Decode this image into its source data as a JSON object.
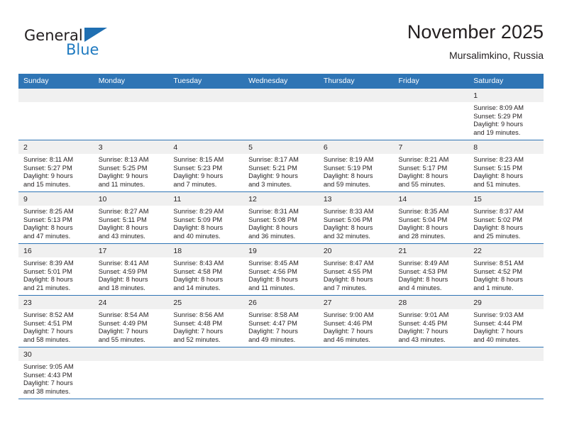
{
  "logo": {
    "word1": "General",
    "word2": "Blue",
    "flag_icon": "blue-flag-triangle-icon",
    "accent_color": "#1f7ac0"
  },
  "header": {
    "title": "November 2025",
    "subtitle": "Mursalimkino, Russia"
  },
  "theme": {
    "header_bg": "#2f75b5",
    "header_text": "#ffffff",
    "daynum_bg": "#f0f0f0",
    "row_border": "#2f75b5",
    "body_text": "#231f20"
  },
  "calendar": {
    "weekday_headers": [
      "Sunday",
      "Monday",
      "Tuesday",
      "Wednesday",
      "Thursday",
      "Friday",
      "Saturday"
    ],
    "weeks": [
      [
        {
          "day": "",
          "info": ""
        },
        {
          "day": "",
          "info": ""
        },
        {
          "day": "",
          "info": ""
        },
        {
          "day": "",
          "info": ""
        },
        {
          "day": "",
          "info": ""
        },
        {
          "day": "",
          "info": ""
        },
        {
          "day": "1",
          "info": "Sunrise: 8:09 AM\nSunset: 5:29 PM\nDaylight: 9 hours\nand 19 minutes."
        }
      ],
      [
        {
          "day": "2",
          "info": "Sunrise: 8:11 AM\nSunset: 5:27 PM\nDaylight: 9 hours\nand 15 minutes."
        },
        {
          "day": "3",
          "info": "Sunrise: 8:13 AM\nSunset: 5:25 PM\nDaylight: 9 hours\nand 11 minutes."
        },
        {
          "day": "4",
          "info": "Sunrise: 8:15 AM\nSunset: 5:23 PM\nDaylight: 9 hours\nand 7 minutes."
        },
        {
          "day": "5",
          "info": "Sunrise: 8:17 AM\nSunset: 5:21 PM\nDaylight: 9 hours\nand 3 minutes."
        },
        {
          "day": "6",
          "info": "Sunrise: 8:19 AM\nSunset: 5:19 PM\nDaylight: 8 hours\nand 59 minutes."
        },
        {
          "day": "7",
          "info": "Sunrise: 8:21 AM\nSunset: 5:17 PM\nDaylight: 8 hours\nand 55 minutes."
        },
        {
          "day": "8",
          "info": "Sunrise: 8:23 AM\nSunset: 5:15 PM\nDaylight: 8 hours\nand 51 minutes."
        }
      ],
      [
        {
          "day": "9",
          "info": "Sunrise: 8:25 AM\nSunset: 5:13 PM\nDaylight: 8 hours\nand 47 minutes."
        },
        {
          "day": "10",
          "info": "Sunrise: 8:27 AM\nSunset: 5:11 PM\nDaylight: 8 hours\nand 43 minutes."
        },
        {
          "day": "11",
          "info": "Sunrise: 8:29 AM\nSunset: 5:09 PM\nDaylight: 8 hours\nand 40 minutes."
        },
        {
          "day": "12",
          "info": "Sunrise: 8:31 AM\nSunset: 5:08 PM\nDaylight: 8 hours\nand 36 minutes."
        },
        {
          "day": "13",
          "info": "Sunrise: 8:33 AM\nSunset: 5:06 PM\nDaylight: 8 hours\nand 32 minutes."
        },
        {
          "day": "14",
          "info": "Sunrise: 8:35 AM\nSunset: 5:04 PM\nDaylight: 8 hours\nand 28 minutes."
        },
        {
          "day": "15",
          "info": "Sunrise: 8:37 AM\nSunset: 5:02 PM\nDaylight: 8 hours\nand 25 minutes."
        }
      ],
      [
        {
          "day": "16",
          "info": "Sunrise: 8:39 AM\nSunset: 5:01 PM\nDaylight: 8 hours\nand 21 minutes."
        },
        {
          "day": "17",
          "info": "Sunrise: 8:41 AM\nSunset: 4:59 PM\nDaylight: 8 hours\nand 18 minutes."
        },
        {
          "day": "18",
          "info": "Sunrise: 8:43 AM\nSunset: 4:58 PM\nDaylight: 8 hours\nand 14 minutes."
        },
        {
          "day": "19",
          "info": "Sunrise: 8:45 AM\nSunset: 4:56 PM\nDaylight: 8 hours\nand 11 minutes."
        },
        {
          "day": "20",
          "info": "Sunrise: 8:47 AM\nSunset: 4:55 PM\nDaylight: 8 hours\nand 7 minutes."
        },
        {
          "day": "21",
          "info": "Sunrise: 8:49 AM\nSunset: 4:53 PM\nDaylight: 8 hours\nand 4 minutes."
        },
        {
          "day": "22",
          "info": "Sunrise: 8:51 AM\nSunset: 4:52 PM\nDaylight: 8 hours\nand 1 minute."
        }
      ],
      [
        {
          "day": "23",
          "info": "Sunrise: 8:52 AM\nSunset: 4:51 PM\nDaylight: 7 hours\nand 58 minutes."
        },
        {
          "day": "24",
          "info": "Sunrise: 8:54 AM\nSunset: 4:49 PM\nDaylight: 7 hours\nand 55 minutes."
        },
        {
          "day": "25",
          "info": "Sunrise: 8:56 AM\nSunset: 4:48 PM\nDaylight: 7 hours\nand 52 minutes."
        },
        {
          "day": "26",
          "info": "Sunrise: 8:58 AM\nSunset: 4:47 PM\nDaylight: 7 hours\nand 49 minutes."
        },
        {
          "day": "27",
          "info": "Sunrise: 9:00 AM\nSunset: 4:46 PM\nDaylight: 7 hours\nand 46 minutes."
        },
        {
          "day": "28",
          "info": "Sunrise: 9:01 AM\nSunset: 4:45 PM\nDaylight: 7 hours\nand 43 minutes."
        },
        {
          "day": "29",
          "info": "Sunrise: 9:03 AM\nSunset: 4:44 PM\nDaylight: 7 hours\nand 40 minutes."
        }
      ],
      [
        {
          "day": "30",
          "info": "Sunrise: 9:05 AM\nSunset: 4:43 PM\nDaylight: 7 hours\nand 38 minutes."
        },
        {
          "day": "",
          "info": ""
        },
        {
          "day": "",
          "info": ""
        },
        {
          "day": "",
          "info": ""
        },
        {
          "day": "",
          "info": ""
        },
        {
          "day": "",
          "info": ""
        },
        {
          "day": "",
          "info": ""
        }
      ]
    ]
  }
}
